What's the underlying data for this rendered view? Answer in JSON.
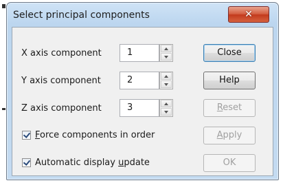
{
  "window": {
    "title": "Select principal components",
    "close_glyph": "✕"
  },
  "components": [
    {
      "label": "X axis component",
      "value": "1"
    },
    {
      "label": "Y axis component",
      "value": "2"
    },
    {
      "label": "Z axis component",
      "value": "3"
    }
  ],
  "buttons": {
    "close": "Close",
    "help": "Help",
    "reset": {
      "pre": "",
      "key": "R",
      "post": "eset"
    },
    "apply": {
      "pre": "",
      "key": "A",
      "post": "pply"
    },
    "ok": "OK"
  },
  "options": {
    "force_order": {
      "pre": "",
      "key": "F",
      "post": "orce components in order",
      "checked": true
    },
    "auto_update": {
      "pre": "Automatic display ",
      "key": "u",
      "post": "pdate",
      "checked": true
    }
  },
  "colors": {
    "title_bar": "#bcd6ef",
    "client": "#f0f0f0",
    "close_button": "#c23a1d"
  }
}
